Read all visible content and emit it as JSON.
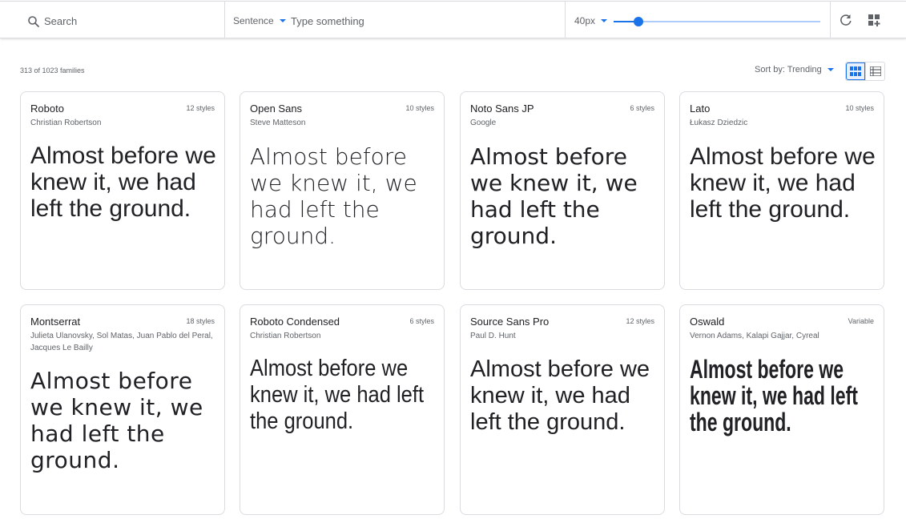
{
  "search": {
    "placeholder": "Search"
  },
  "preview": {
    "mode": "Sentence",
    "placeholder": "Type something"
  },
  "size": {
    "label": "40px",
    "slider_fraction": 0.12
  },
  "toolbar_icons": [
    "search-icon",
    "caret-icon",
    "refresh-icon",
    "grid-add-icon"
  ],
  "results": {
    "count_text": "313 of 1023 families"
  },
  "sort": {
    "label": "Sort by: Trending"
  },
  "view": {
    "options": [
      "grid-view-icon",
      "list-view-icon"
    ],
    "active": "grid"
  },
  "accent_color": "#1a73e8",
  "fonts": [
    {
      "name": "Roboto",
      "styles": "12 styles",
      "designer": "Christian Robertson",
      "sample": "Almost before we knew it, we had left the ground."
    },
    {
      "name": "Open Sans",
      "styles": "10 styles",
      "designer": "Steve Matteson",
      "sample": "Almost before we knew it, we had left the ground."
    },
    {
      "name": "Noto Sans JP",
      "styles": "6 styles",
      "designer": "Google",
      "sample": "Almost before we knew it, we had left the ground."
    },
    {
      "name": "Lato",
      "styles": "10 styles",
      "designer": "Łukasz Dziedzic",
      "sample": "Almost before we knew it, we had left the ground."
    },
    {
      "name": "Montserrat",
      "styles": "18 styles",
      "designer": "Julieta Ulanovsky, Sol Matas, Juan Pablo del Peral, Jacques Le Bailly",
      "sample": "Almost before we knew it, we had left the ground."
    },
    {
      "name": "Roboto Condensed",
      "styles": "6 styles",
      "designer": "Christian Robertson",
      "sample": "Almost before we knew it, we had left the ground."
    },
    {
      "name": "Source Sans Pro",
      "styles": "12 styles",
      "designer": "Paul D. Hunt",
      "sample": "Almost before we knew it, we had left the ground."
    },
    {
      "name": "Oswald",
      "styles": "Variable",
      "designer": "Vernon Adams, Kalapi Gajjar, Cyreal",
      "sample": "Almost before we knew it, we had left the ground."
    }
  ]
}
